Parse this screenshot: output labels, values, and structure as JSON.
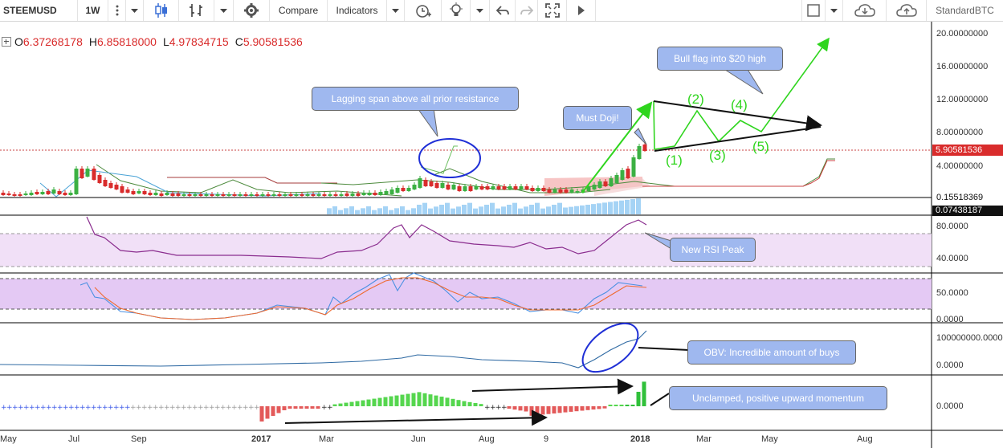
{
  "toolbar": {
    "symbol": "STEEMUSD",
    "interval": "1W",
    "compare_label": "Compare",
    "indicators_label": "Indicators",
    "account_label": "StandardBTC",
    "icons": [
      "more-vert-icon",
      "chevron-down-icon",
      "candles-icon",
      "bar-style-icon",
      "gear-icon",
      "alert-clock-icon",
      "bulb-icon",
      "undo-icon",
      "redo-icon",
      "fullscreen-icon",
      "play-icon",
      "square-icon",
      "cloud-down-icon",
      "cloud-up-icon"
    ]
  },
  "ohlc": {
    "o_label": "O",
    "o": "6.37268178",
    "h_label": "H",
    "h": "6.85818000",
    "l_label": "L",
    "l": "4.97834715",
    "c_label": "C",
    "c": "5.90581536"
  },
  "annotations": {
    "lagging_span": "Lagging span above all prior resistance",
    "must_doji": "Must Doji!",
    "bull_flag": "Bull flag into $20 high",
    "new_rsi_peak": "New RSI Peak",
    "obv": "OBV: Incredible amount of buys",
    "momentum": "Unclamped, positive upward momentum",
    "wave1": "(1)",
    "wave2": "(2)",
    "wave3": "(3)",
    "wave4": "(4)",
    "wave5": "(5)"
  },
  "price_axis": {
    "ticks": [
      "20.00000000",
      "16.00000000",
      "12.00000000",
      "8.00000000",
      "4.00000000"
    ],
    "current_price": "5.90581536",
    "low_label": "0.15518369",
    "volume_label": "0.07438187"
  },
  "rsi_axis": {
    "ticks": [
      "80.0000",
      "40.0000"
    ]
  },
  "stoch_axis": {
    "ticks": [
      "50.0000",
      "0.0000"
    ]
  },
  "obv_axis": {
    "ticks": [
      "100000000.0000",
      "0.0000"
    ]
  },
  "mom_axis": {
    "ticks": [
      "0.0000"
    ]
  },
  "time_axis": [
    "May",
    "Jul",
    "Sep",
    "2017",
    "Mar",
    "Jun",
    "Aug",
    "9",
    "2018",
    "Mar",
    "May",
    "Aug"
  ],
  "colors": {
    "up": "#3cb043",
    "down": "#d92c2c",
    "bubble": "#9fb8ef",
    "wave": "#2fd51e",
    "rsi": "#8a2c8e",
    "obv": "#2f6aa3",
    "stoch_k": "#4a90e2",
    "stoch_d": "#ef6a2f",
    "ichimoku": "#4c8a3c"
  }
}
